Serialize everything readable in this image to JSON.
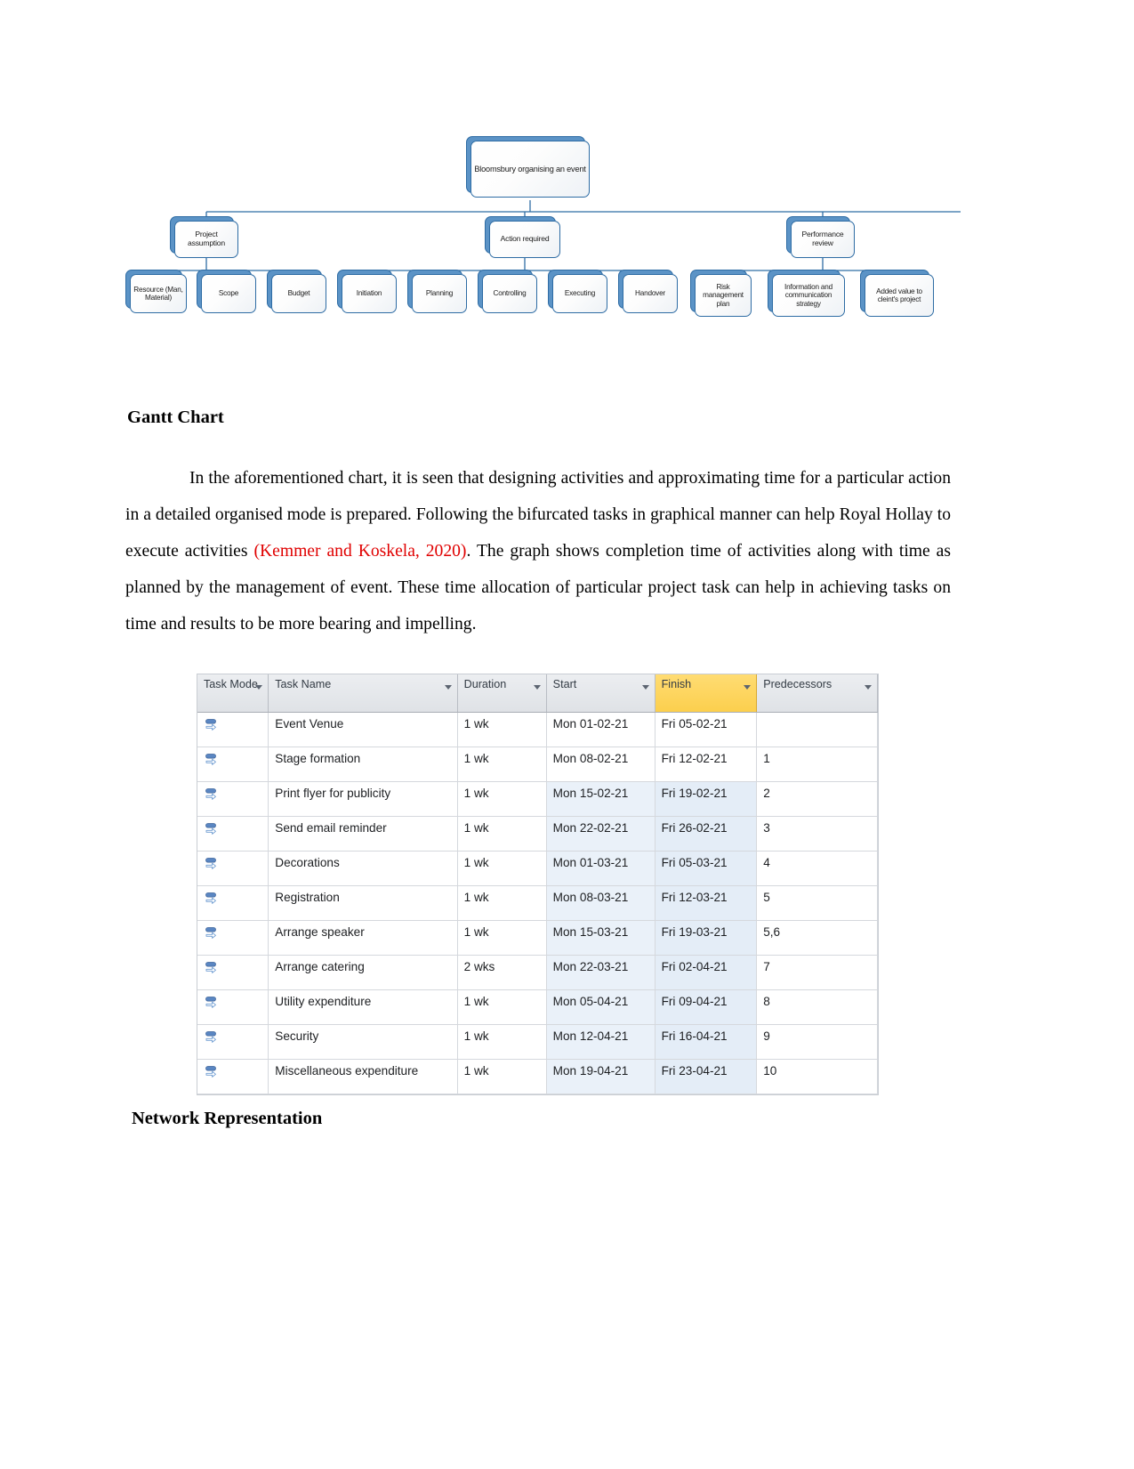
{
  "org_chart": {
    "root": {
      "label": "Bloomsbury organising an event"
    },
    "level2": [
      {
        "label": "Project assumption"
      },
      {
        "label": "Action required"
      },
      {
        "label": "Performance review"
      }
    ],
    "level3": [
      {
        "label": "Resource (Man, Material)"
      },
      {
        "label": "Scope"
      },
      {
        "label": "Budget"
      },
      {
        "label": "Initiation"
      },
      {
        "label": "Planning"
      },
      {
        "label": "Controlling"
      },
      {
        "label": "Executing"
      },
      {
        "label": "Handover"
      },
      {
        "label": "Risk management plan"
      },
      {
        "label": "Information and communication strategy"
      },
      {
        "label": "Added value to cleint's project"
      }
    ],
    "colors": {
      "border": "#2e6ca4",
      "shadow": "#5b93c6",
      "fill": "#ffffff"
    }
  },
  "headings": {
    "gantt_chart": "Gantt Chart",
    "network_representation": "Network Representation"
  },
  "paragraph": {
    "part1": "In the aforementioned chart, it is seen that designing activities and approximating time for a particular action in a detailed organised mode is prepared. Following the bifurcated tasks in graphical manner can help Royal Hollay to execute activities ",
    "citation": "(Kemmer and Koskela, 2020)",
    "part2": ". The graph shows completion time of activities along with time as planned by the management of event. These time allocation of particular project task can help in achieving tasks on time and results to be more bearing and impelling."
  },
  "gantt_table": {
    "columns": [
      {
        "label": "Task Mode",
        "highlighted": false
      },
      {
        "label": "Task Name",
        "highlighted": false
      },
      {
        "label": "Duration",
        "highlighted": false
      },
      {
        "label": "Start",
        "highlighted": false
      },
      {
        "label": "Finish",
        "highlighted": true
      },
      {
        "label": "Predecessors",
        "highlighted": false
      }
    ],
    "highlight_color": "#fccf4d",
    "rows": [
      {
        "mode": "auto-scheduled-icon",
        "name": "Event Venue",
        "duration": "1 wk",
        "start": "Mon 01-02-21",
        "finish": "Fri 05-02-21",
        "predecessors": ""
      },
      {
        "mode": "auto-scheduled-icon",
        "name": "Stage formation",
        "duration": "1 wk",
        "start": "Mon 08-02-21",
        "finish": "Fri 12-02-21",
        "predecessors": "1"
      },
      {
        "mode": "auto-scheduled-icon",
        "name": "Print flyer for publicity",
        "duration": "1 wk",
        "start": "Mon 15-02-21",
        "finish": "Fri 19-02-21",
        "predecessors": "2"
      },
      {
        "mode": "auto-scheduled-icon",
        "name": "Send email reminder",
        "duration": "1 wk",
        "start": "Mon 22-02-21",
        "finish": "Fri 26-02-21",
        "predecessors": "3"
      },
      {
        "mode": "auto-scheduled-icon",
        "name": "Decorations",
        "duration": "1 wk",
        "start": "Mon 01-03-21",
        "finish": "Fri 05-03-21",
        "predecessors": "4"
      },
      {
        "mode": "auto-scheduled-icon",
        "name": "Registration",
        "duration": "1 wk",
        "start": "Mon 08-03-21",
        "finish": "Fri 12-03-21",
        "predecessors": "5"
      },
      {
        "mode": "auto-scheduled-icon",
        "name": "Arrange speaker",
        "duration": "1 wk",
        "start": "Mon 15-03-21",
        "finish": "Fri 19-03-21",
        "predecessors": "5,6"
      },
      {
        "mode": "auto-scheduled-icon",
        "name": "Arrange catering",
        "duration": "2 wks",
        "start": "Mon 22-03-21",
        "finish": "Fri 02-04-21",
        "predecessors": "7"
      },
      {
        "mode": "auto-scheduled-icon",
        "name": "Utility expenditure",
        "duration": "1 wk",
        "start": "Mon 05-04-21",
        "finish": "Fri 09-04-21",
        "predecessors": "8"
      },
      {
        "mode": "auto-scheduled-icon",
        "name": "Security",
        "duration": "1 wk",
        "start": "Mon 12-04-21",
        "finish": "Fri 16-04-21",
        "predecessors": "9"
      },
      {
        "mode": "auto-scheduled-icon",
        "name": "Miscellaneous expenditure",
        "duration": "1 wk",
        "start": "Mon 19-04-21",
        "finish": "Fri 23-04-21",
        "predecessors": "10"
      }
    ]
  }
}
